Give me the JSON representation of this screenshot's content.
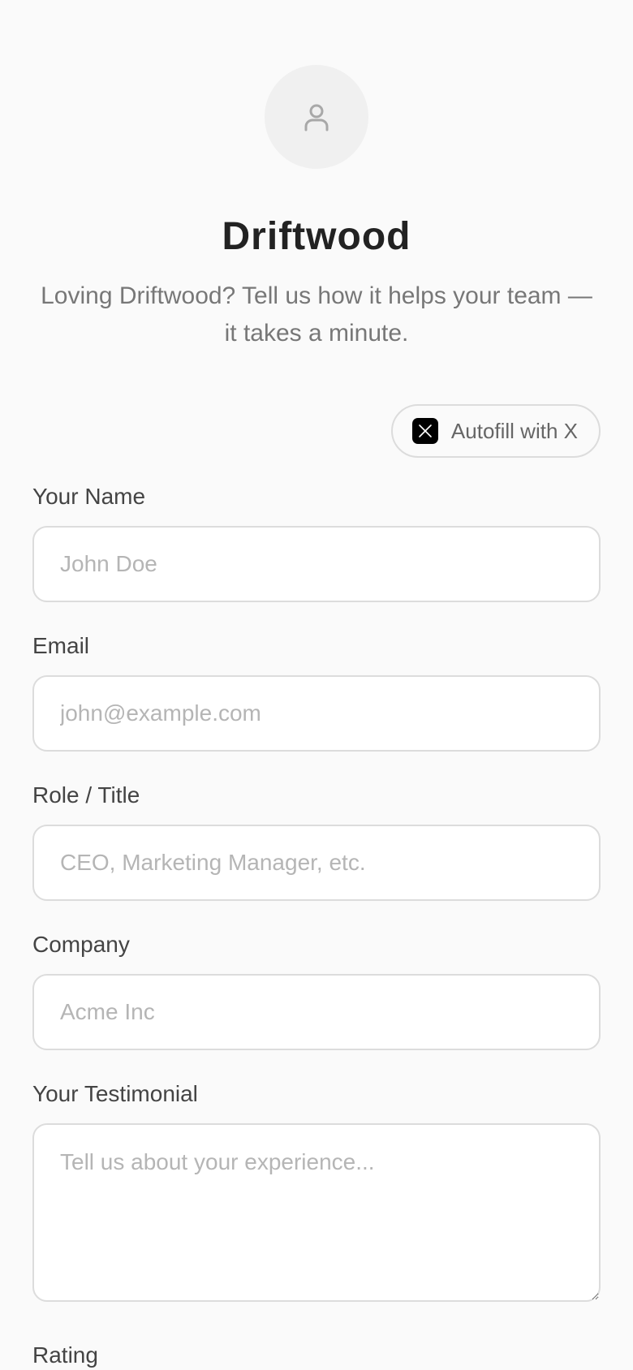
{
  "header": {
    "title": "Driftwood",
    "subtitle": "Loving Driftwood? Tell us how it helps your team — it takes a minute."
  },
  "autofill": {
    "label": "Autofill with X",
    "icon": "x-logo-icon"
  },
  "form": {
    "name": {
      "label": "Your Name",
      "placeholder": "John Doe",
      "value": ""
    },
    "email": {
      "label": "Email",
      "placeholder": "john@example.com",
      "value": ""
    },
    "role": {
      "label": "Role / Title",
      "placeholder": "CEO, Marketing Manager, etc.",
      "value": ""
    },
    "company": {
      "label": "Company",
      "placeholder": "Acme Inc",
      "value": ""
    },
    "testimonial": {
      "label": "Your Testimonial",
      "placeholder": "Tell us about your experience...",
      "value": ""
    },
    "rating": {
      "label": "Rating"
    }
  },
  "icons": {
    "avatar": "user-icon"
  },
  "colors": {
    "background": "#fafafa",
    "title": "#222222",
    "subtitle": "#777777",
    "border": "#dcdcdc",
    "placeholder": "#b5b5b5"
  }
}
